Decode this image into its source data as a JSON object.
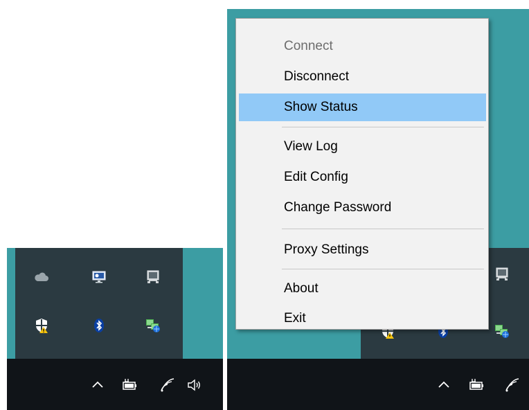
{
  "menu": {
    "items": [
      {
        "label": "Connect",
        "state": "disabled"
      },
      {
        "label": "Disconnect"
      },
      {
        "label": "Show Status",
        "state": "highlighted"
      },
      {
        "label": "View Log"
      },
      {
        "label": "Edit Config"
      },
      {
        "label": "Change Password"
      },
      {
        "label": "Proxy Settings"
      },
      {
        "label": "About"
      },
      {
        "label": "Exit"
      }
    ]
  },
  "tray_icons": [
    "onedrive-cloud-icon",
    "display-monitor-icon",
    "network-computer-icon",
    "security-shield-warning-icon",
    "bluetooth-icon",
    "vpn-network-icon"
  ],
  "taskbar_icons": [
    "chevron-up-icon",
    "battery-plug-icon",
    "wifi-icon",
    "volume-icon"
  ],
  "colors": {
    "desktop": "#3c9da3",
    "tray_flyout": "#2b3a41",
    "taskbar": "#101418",
    "menu_background": "#f2f2f2",
    "menu_highlight": "#91c9f7",
    "disabled_text": "#6d6d6d"
  }
}
